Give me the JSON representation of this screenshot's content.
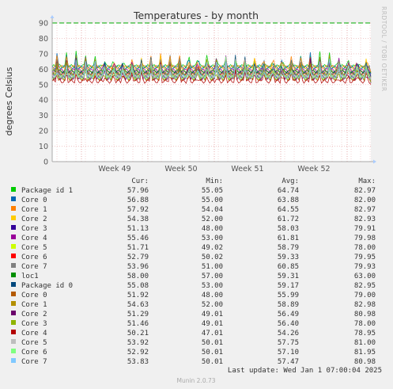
{
  "chart_data": {
    "type": "line",
    "title": "Temperatures - by month",
    "ylabel": "degrees Celsius",
    "xlabel": "",
    "ylim": [
      0,
      90
    ],
    "yticks": [
      0,
      10,
      20,
      30,
      40,
      50,
      60,
      70,
      80,
      90
    ],
    "xticks": [
      "Week 49",
      "Week 50",
      "Week 51",
      "Week 52"
    ],
    "grid": true,
    "warning_line": 90,
    "side_text": "RRDTOOL / TOBI OETIKER",
    "legend_headers": [
      "Cur:",
      "Min:",
      "Avg:",
      "Max:"
    ],
    "series": [
      {
        "name": "Package id 1",
        "color": "#00cc00",
        "cur": "57.96",
        "min": "55.05",
        "avg": "64.74",
        "max": "82.97"
      },
      {
        "name": "Core 0",
        "color": "#0066b3",
        "cur": "56.88",
        "min": "55.00",
        "avg": "63.88",
        "max": "82.00"
      },
      {
        "name": "Core 1",
        "color": "#ff8000",
        "cur": "57.92",
        "min": "54.04",
        "avg": "64.55",
        "max": "82.97"
      },
      {
        "name": "Core 2",
        "color": "#ffcc00",
        "cur": "54.38",
        "min": "52.00",
        "avg": "61.72",
        "max": "82.93"
      },
      {
        "name": "Core 3",
        "color": "#330099",
        "cur": "51.13",
        "min": "48.00",
        "avg": "58.03",
        "max": "79.91"
      },
      {
        "name": "Core 4",
        "color": "#990099",
        "cur": "55.46",
        "min": "53.00",
        "avg": "61.81",
        "max": "79.98"
      },
      {
        "name": "Core 5",
        "color": "#ccff00",
        "cur": "51.71",
        "min": "49.02",
        "avg": "58.79",
        "max": "78.00"
      },
      {
        "name": "Core 6",
        "color": "#ff0000",
        "cur": "52.79",
        "min": "50.02",
        "avg": "59.33",
        "max": "79.95"
      },
      {
        "name": "Core 7",
        "color": "#808080",
        "cur": "53.96",
        "min": "51.00",
        "avg": "60.85",
        "max": "79.93"
      },
      {
        "name": "loc1",
        "color": "#008f00",
        "cur": "58.00",
        "min": "57.00",
        "avg": "59.31",
        "max": "63.00"
      },
      {
        "name": "Package id 0",
        "color": "#00487d",
        "cur": "55.08",
        "min": "53.00",
        "avg": "59.17",
        "max": "82.95"
      },
      {
        "name": "Core 0",
        "color": "#b35a00",
        "cur": "51.92",
        "min": "48.00",
        "avg": "55.99",
        "max": "79.00"
      },
      {
        "name": "Core 1",
        "color": "#b38f00",
        "cur": "54.63",
        "min": "52.00",
        "avg": "58.89",
        "max": "82.98"
      },
      {
        "name": "Core 2",
        "color": "#6b006b",
        "cur": "51.29",
        "min": "49.01",
        "avg": "56.49",
        "max": "80.98"
      },
      {
        "name": "Core 3",
        "color": "#8fb300",
        "cur": "51.46",
        "min": "49.01",
        "avg": "56.40",
        "max": "78.00"
      },
      {
        "name": "Core 4",
        "color": "#b30000",
        "cur": "50.21",
        "min": "47.01",
        "avg": "54.26",
        "max": "78.95"
      },
      {
        "name": "Core 5",
        "color": "#bebebe",
        "cur": "53.92",
        "min": "50.01",
        "avg": "57.75",
        "max": "81.00"
      },
      {
        "name": "Core 6",
        "color": "#80ff80",
        "cur": "52.92",
        "min": "50.01",
        "avg": "57.10",
        "max": "81.95"
      },
      {
        "name": "Core 7",
        "color": "#80c9ff",
        "cur": "53.83",
        "min": "50.01",
        "avg": "57.47",
        "max": "80.98"
      }
    ],
    "last_update": "Last update: Wed Jan  1 07:00:04 2025",
    "footer": "Munin 2.0.73"
  }
}
